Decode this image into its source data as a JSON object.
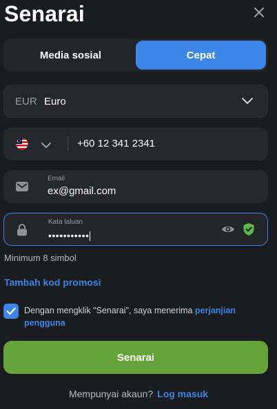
{
  "header": {
    "title": "Senarai",
    "close_icon": "close-icon"
  },
  "tabs": [
    {
      "label": "Media sosial",
      "active": false
    },
    {
      "label": "Cepat",
      "active": true
    }
  ],
  "currency": {
    "code": "EUR",
    "name": "Euro"
  },
  "phone": {
    "flag": "malaysia-flag-icon",
    "value": "+60 12 341 2341"
  },
  "email": {
    "label": "Email",
    "value": "ex@gmail.com"
  },
  "password": {
    "label": "Kata laluan",
    "masked_value": "•••••••••••"
  },
  "password_hint": "Minimum 8 simbol",
  "promo_link": "Tambah kod promosi",
  "consent": {
    "checked": true,
    "text": "Dengan mengklik \"Senarai\", saya menerima ",
    "link": "perjanjian pengguna"
  },
  "submit_label": "Senarai",
  "footer": {
    "question": "Mempunyai akaun?",
    "login_link": "Log masuk"
  },
  "colors": {
    "accent": "#3d85e6",
    "submit": "#66a33a",
    "background": "#1b1c1f",
    "field": "#26272c",
    "shield": "#5fb84a"
  }
}
